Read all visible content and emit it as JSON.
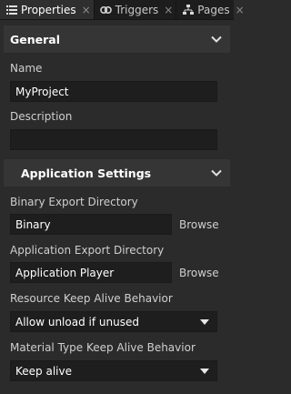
{
  "tabs": [
    {
      "label": "Properties",
      "icon": "list-icon",
      "active": true,
      "close": "×"
    },
    {
      "label": "Triggers",
      "icon": "link-icon",
      "active": false,
      "close": "×"
    },
    {
      "label": "Pages",
      "icon": "hierarchy-icon",
      "active": false,
      "close": "×"
    }
  ],
  "general": {
    "title": "General",
    "name_label": "Name",
    "name_value": "MyProject",
    "description_label": "Description",
    "description_value": ""
  },
  "app_settings": {
    "title": "Application Settings",
    "binary_export_label": "Binary Export Directory",
    "binary_export_value": "Binary",
    "app_export_label": "Application Export Directory",
    "app_export_value": "Application Player",
    "browse_label": "Browse",
    "resource_keep_alive_label": "Resource Keep Alive Behavior",
    "resource_keep_alive_value": "Allow unload if unused",
    "material_keep_alive_label": "Material Type Keep Alive Behavior",
    "material_keep_alive_value": "Keep alive"
  },
  "colors": {
    "background": "#2b2b2b",
    "header_bg": "#353535",
    "field_bg": "#1e1e1e",
    "tabbar_bg": "#1d1d1d"
  }
}
